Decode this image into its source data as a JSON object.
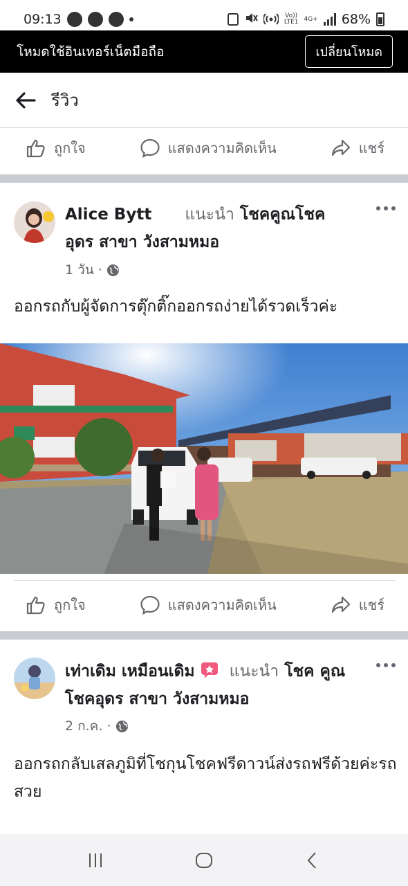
{
  "status_bar": {
    "time": "09:13",
    "network_top": "Vo))",
    "network_bottom": "LTE1",
    "net_type": "4G+",
    "battery": "68%"
  },
  "mode_bar": {
    "text": "โหมดใช้อินเทอร์เน็ตมือถือ",
    "button": "เปลี่ยนโหมด"
  },
  "header": {
    "title": "รีวิว"
  },
  "actions": {
    "like": "ถูกใจ",
    "comment": "แสดงความคิดเห็น",
    "share": "แชร์"
  },
  "posts": [
    {
      "author": "Alice Bytt",
      "recommends": "แนะนำ",
      "page": "โชคคูณโชค อุดร สาขา วังสามหมอ",
      "time": "1 วัน ·",
      "text": "ออกรถกับผู้จัดการตุ๊กติ๊กออกรถง่ายได้รวดเร็วค่ะ"
    },
    {
      "author": "เท่าเดิม เหมือนเดิม",
      "recommends": "แนะนำ",
      "page": "โชค คูณโชคอุดร สาขา วังสามหมอ",
      "time": "2 ก.ค. ·",
      "text": "ออกรถกลับเสลภูมิที่โชกุนโชคฟรีดาวน์ส่งรถฟรีด้วยค่ะรถสวย"
    }
  ],
  "colors": {
    "mode_bar_bg": "#000000",
    "divider": "#c9ccd1",
    "secondary_text": "#65676b"
  }
}
